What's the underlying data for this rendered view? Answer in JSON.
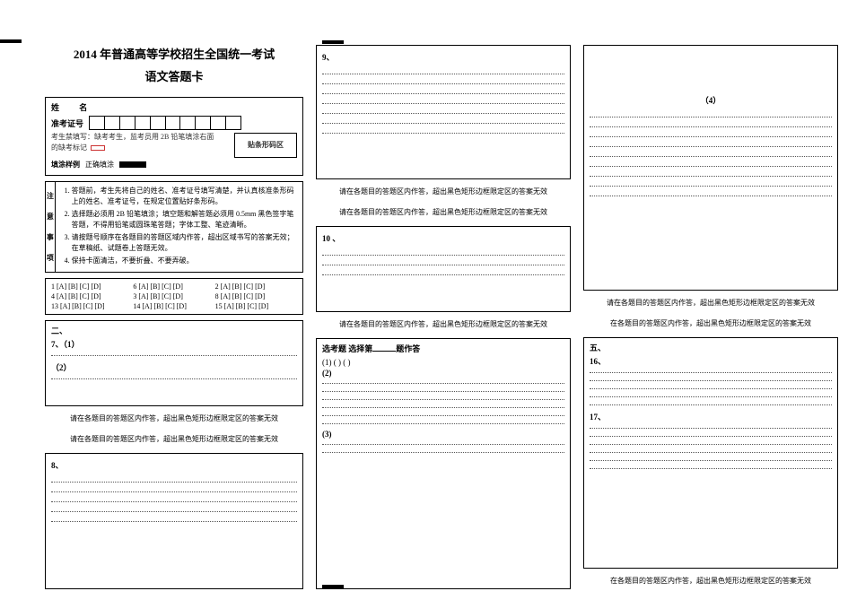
{
  "header": {
    "title": "2014 年普通高等学校招生全国统一考试",
    "subtitle": "语文答题卡"
  },
  "info": {
    "name_label": "姓    名",
    "exam_no_label": "准考证号",
    "fill_hint_1": "考生禁填写：缺考考生，监考员用 2B 铅笔填涂右面",
    "fill_hint_2": "的缺考标记",
    "barcode_label": "贴条形码区",
    "fill_example_label": "填涂样例",
    "fill_example_good": "正确填涂"
  },
  "attention": {
    "side": [
      "注",
      "意",
      "事",
      "项"
    ],
    "items": [
      "答题前，考生先将自己的姓名、准考证号填写清楚，并认真核准条形码上的姓名、准考证号，在规定位置贴好条形码。",
      "选择题必须用 2B 铅笔填涂；填空题和解答题必须用 0.5mm 黑色签字笔答题，不得用铅笔或圆珠笔答题；字体工整、笔迹清晰。",
      "请按题号顺序在各题目的答题区域内作答，超出区域书写的答案无效；在草稿纸、试题卷上答题无效。",
      "保持卡面清洁，不要折叠、不要弄破。"
    ]
  },
  "mcq": {
    "rows": [
      [
        "1   [A] [B] [C] [D]",
        "6   [A] [B] [C] [D]",
        "2   [A] [B] [C] [D]"
      ],
      [
        "4   [A] [B] [C] [D]",
        "3   [A] [B] [C] [D]",
        "8   [A] [B] [C] [D]"
      ],
      [
        "13 [A] [B] [C] [D]",
        "14 [A] [B] [C] [D]",
        "15 [A] [B] [C] [D]"
      ]
    ]
  },
  "labels": {
    "section2": "二、",
    "q7_1": "7、（1）",
    "q7_2": "（2）",
    "q8": "8、",
    "q9": "9、",
    "q10": "10 、",
    "q4": "（4）",
    "section5": "五、",
    "q16": "16、",
    "q17": "17、",
    "opt_prefix": "选考题    选择第",
    "opt_suffix": "题作答",
    "opt_row": "(1) (            ) (            )",
    "opt_2": "(2)",
    "opt_3": "(3)",
    "notice_full": "请在各题目的答题区内作答，超出黑色矩形边框限定区的答案无效",
    "notice_short": "在各题目的答题区内作答，超出黑色矩形边框限定区的答案无效"
  }
}
